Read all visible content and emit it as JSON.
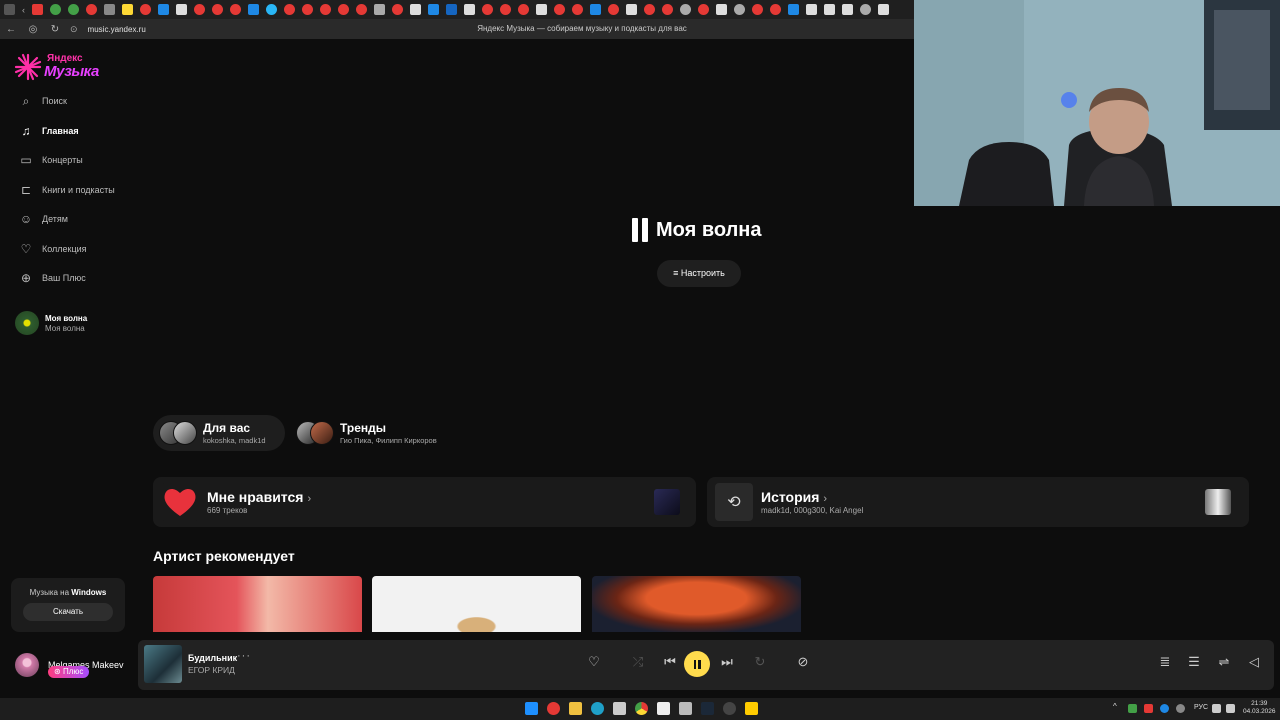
{
  "browser": {
    "url": "music.yandex.ru",
    "page_title": "Яндекс Музыка — собираем музыку и подкасты для вас"
  },
  "logo": {
    "small": "Яндекс",
    "big": "Музыка"
  },
  "sidebar": {
    "items": [
      {
        "label": "Поиск",
        "icon": "search-icon"
      },
      {
        "label": "Главная",
        "icon": "music-note-icon"
      },
      {
        "label": "Концерты",
        "icon": "ticket-icon"
      },
      {
        "label": "Книги и подкасты",
        "icon": "book-icon"
      },
      {
        "label": "Детям",
        "icon": "kids-icon"
      },
      {
        "label": "Коллекция",
        "icon": "heart-icon"
      },
      {
        "label": "Ваш Плюс",
        "icon": "plus-icon"
      }
    ],
    "wave": {
      "title": "Моя волна",
      "subtitle": "Моя волна"
    },
    "windows_promo": {
      "text_prefix": "Музыка на",
      "text_bold": "Windows",
      "button": "Скачать"
    },
    "user": {
      "name": "Melgames Makeev",
      "badge": "Плюс"
    }
  },
  "main": {
    "wave_title": "Моя волна",
    "tune_button": "Настроить",
    "chips": [
      {
        "title": "Для вас",
        "subtitle": "kokoshka, madk1d"
      },
      {
        "title": "Тренды",
        "subtitle": "Гио Пика, Филипп Киркоров"
      }
    ],
    "cards": [
      {
        "title": "Мне нравится",
        "subtitle": "669 треков"
      },
      {
        "title": "История",
        "subtitle": "madk1d, 000g300, Kai Angel"
      }
    ],
    "section_title": "Артист рекомендует"
  },
  "player": {
    "title": "Будильник",
    "more": "···",
    "artist": "ЕГОР КРИД"
  },
  "taskbar": {
    "lang": "РУС",
    "time": "21:39",
    "date": "04.03.2026"
  },
  "colors": {
    "accent_yellow": "#ffdb4d",
    "logo_pink": "#e740ff",
    "background": "#0d0d0d"
  }
}
